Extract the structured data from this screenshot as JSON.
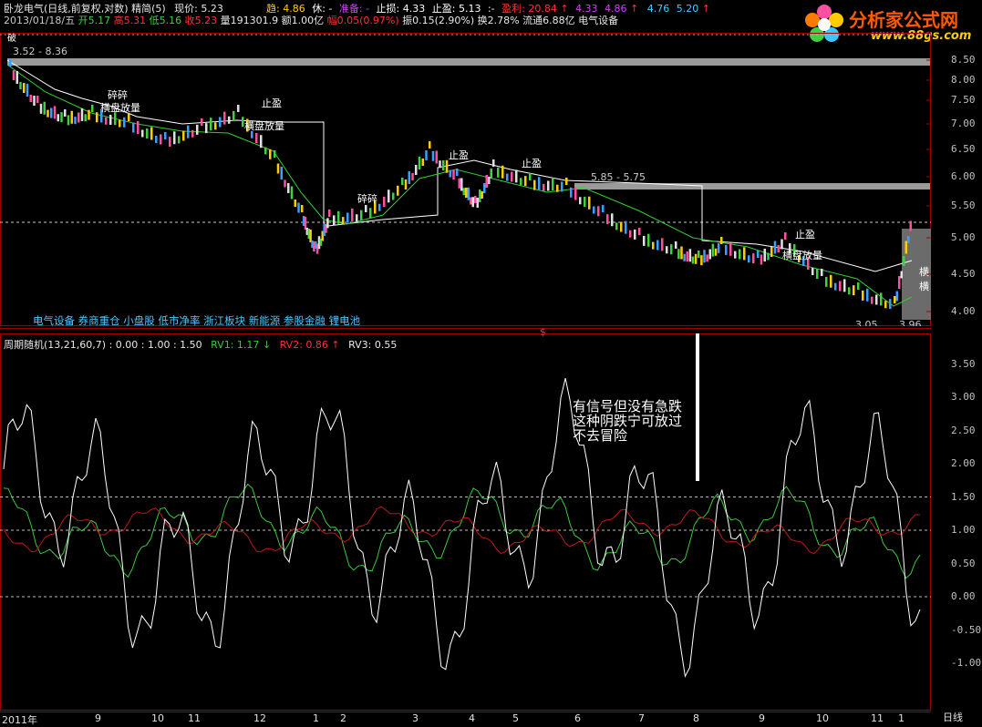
{
  "header": {
    "stock": "卧龙电气(日线,前复权,对数) 精简(5)",
    "price_label": "现价: 5.23",
    "trend_label": "趋: 4.86",
    "rest_label": "休: -",
    "ready_label": "准备: -",
    "stoploss_label": "止损: 4.33",
    "takeprofit_label": "止盈: 5.13",
    "profit_label": "盈利: 20.84",
    "v1": "4.33",
    "v2": "4.86",
    "v3": "4.76",
    "v4": "5.20",
    "dash": ":-"
  },
  "quote": {
    "date": "2013/01/18/五",
    "open": "开5.17",
    "high": "高5.31",
    "low": "低5.16",
    "close": "收5.23",
    "volume": "量191301.9",
    "amount": "额1.00亿",
    "change": "幅0.05(0.97%)",
    "amplitude": "振0.15(2.90%)",
    "turnover": "换2.78%",
    "float": "流通6.88亿",
    "sector": "电气设备"
  },
  "logo": {
    "title": "分析家公式网",
    "url": "www.88gs.com"
  },
  "price_axis": [
    "8.50",
    "8.00",
    "7.50",
    "7.00",
    "6.50",
    "6.00",
    "5.50",
    "5.00",
    "4.50",
    "4.00"
  ],
  "range_labels": {
    "top": "3.52 - 8.36",
    "mid": "5.85 - 5.75",
    "low": "3.05",
    "low2": "3.96"
  },
  "annotations": {
    "breakout": "破",
    "breakout2": "碎碎",
    "stop": "止盈",
    "volume": "横盘放量",
    "cross": "横"
  },
  "concepts": "电气设备 券商重仓 小盘股 低市净率 浙江板块 新能源 参股金融 锂电池",
  "divider_marker": "$",
  "indicator": {
    "name": "周期随机(13,21,60,7)",
    "levels": ": 0.00 : 1.00 : 1.50",
    "rv1": "RV1: 1.17",
    "rv2": "RV2: 0.86",
    "rv3": "RV3: 0.55",
    "colors": {
      "rv1": "#3cc83c",
      "rv2": "#c01818",
      "rv3": "#ffffff"
    }
  },
  "indicator_axis": [
    "3.50",
    "3.00",
    "2.50",
    "2.00",
    "1.50",
    "1.00",
    "0.50",
    "0.00",
    "-0.50",
    "-1.00"
  ],
  "note_lines": [
    "有信号但没有急跌",
    "这种阴跌宁可放过",
    "不去冒险"
  ],
  "x_axis": [
    {
      "label": "2011年"
    },
    {
      "label": "9"
    },
    {
      "label": "10"
    },
    {
      "label": "11"
    },
    {
      "label": "12"
    },
    {
      "label": "1"
    },
    {
      "label": "2"
    },
    {
      "label": "3"
    },
    {
      "label": "4"
    },
    {
      "label": "5"
    },
    {
      "label": "6"
    },
    {
      "label": "7"
    },
    {
      "label": "8"
    },
    {
      "label": "9"
    },
    {
      "label": "10"
    },
    {
      "label": "11"
    },
    {
      "label": "1"
    }
  ],
  "period": "日线"
}
